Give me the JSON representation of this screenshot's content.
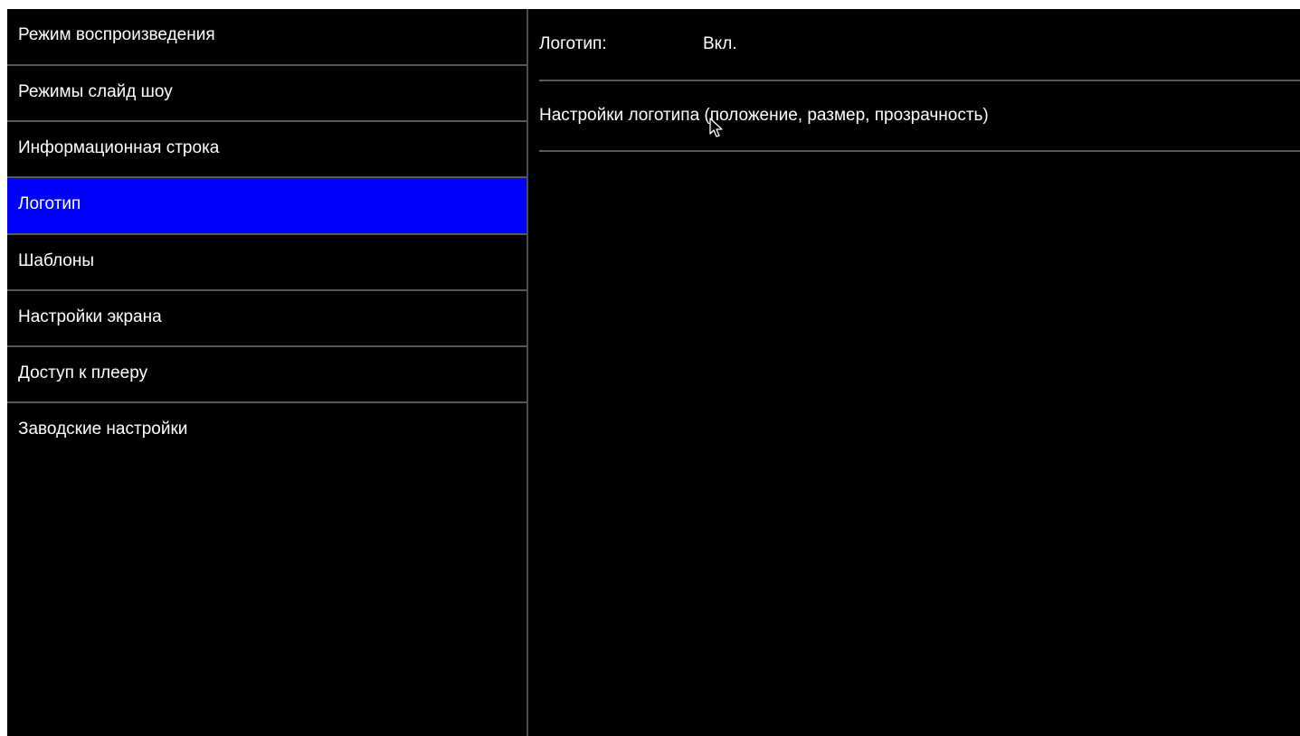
{
  "sidebar": {
    "items": [
      {
        "label": "Режим воспроизведения",
        "selected": false
      },
      {
        "label": "Режимы слайд шоу",
        "selected": false
      },
      {
        "label": "Информационная строка",
        "selected": false
      },
      {
        "label": "Логотип",
        "selected": true
      },
      {
        "label": "Шаблоны",
        "selected": false
      },
      {
        "label": "Настройки экрана",
        "selected": false
      },
      {
        "label": "Доступ к плееру",
        "selected": false
      },
      {
        "label": "Заводские настройки",
        "selected": false
      }
    ]
  },
  "panel": {
    "logo_toggle": {
      "label": "Логотип:",
      "value": "Вкл."
    },
    "logo_settings": {
      "label": "Настройки логотипа (положение, размер, прозрачность)"
    }
  },
  "colors": {
    "background": "#000000",
    "selection": "#0000ff",
    "text": "#ffffff",
    "divider": "#5a5a5a"
  },
  "icons": {
    "cursor": "mouse-pointer-icon"
  }
}
